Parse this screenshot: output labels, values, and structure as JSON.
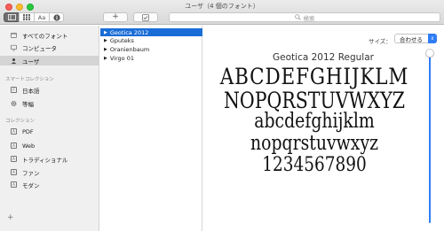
{
  "window": {
    "title": "ユーザ（4 個のフォント）"
  },
  "toolbar": {
    "view_buttons": [
      {
        "icon": "sidebar-icon"
      },
      {
        "icon": "grid-icon"
      },
      {
        "label": "Aa",
        "icon": "sample-text-icon"
      },
      {
        "icon": "info-icon"
      }
    ],
    "add_label": "+",
    "check_icon": "checkbox-icon",
    "search_placeholder": "検索"
  },
  "sidebar": {
    "collections_top": [
      {
        "label": "すべてのフォント",
        "icon": "all-fonts-icon",
        "selected": false
      },
      {
        "label": "コンピュータ",
        "icon": "computer-icon",
        "selected": false
      },
      {
        "label": "ユーザ",
        "icon": "user-icon",
        "selected": true
      }
    ],
    "smart_header": "スマートコレクション",
    "smart": [
      {
        "label": "日本語",
        "icon": "font-box-icon"
      },
      {
        "label": "等幅",
        "icon": "gear-icon"
      }
    ],
    "collection_header": "コレクション",
    "collections": [
      {
        "label": "PDF",
        "icon": "font-box-icon"
      },
      {
        "label": "Web",
        "icon": "font-box-icon"
      },
      {
        "label": "トラディショナル",
        "icon": "font-box-icon"
      },
      {
        "label": "ファン",
        "icon": "font-box-icon"
      },
      {
        "label": "モダン",
        "icon": "font-box-icon"
      }
    ],
    "add_label": "+"
  },
  "fonts": [
    {
      "name": "Geotica 2012",
      "selected": true
    },
    {
      "name": "Gputeks",
      "selected": false
    },
    {
      "name": "Oranienbaum",
      "selected": false
    },
    {
      "name": "Virgo 01",
      "selected": false
    }
  ],
  "preview": {
    "size_label": "サイズ：",
    "size_value": "合わせる",
    "font_title": "Geotica 2012 Regular",
    "lines": [
      "ABCDEFGHIJKLM",
      "NOPQRSTUVWXYZ",
      "abcdefghijklm",
      "nopqrstuvwxyz",
      "1234567890"
    ]
  },
  "colors": {
    "accent": "#1a6dd6",
    "sidebar_bg": "#f0f0f0"
  }
}
